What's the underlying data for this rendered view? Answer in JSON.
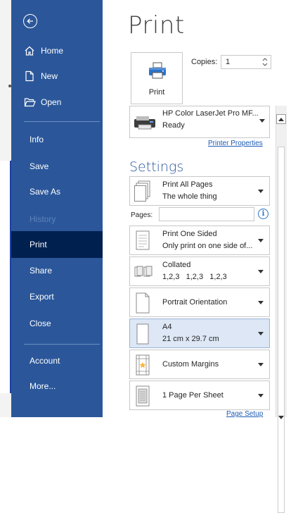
{
  "sidebar": {
    "items": [
      {
        "label": "Home",
        "icon": "home-icon"
      },
      {
        "label": "New",
        "icon": "new-document-icon"
      },
      {
        "label": "Open",
        "icon": "open-folder-icon"
      },
      {
        "label": "Info"
      },
      {
        "label": "Save"
      },
      {
        "label": "Save As"
      },
      {
        "label": "History"
      },
      {
        "label": "Print"
      },
      {
        "label": "Share"
      },
      {
        "label": "Export"
      },
      {
        "label": "Close"
      },
      {
        "label": "Account"
      },
      {
        "label": "More..."
      }
    ]
  },
  "main": {
    "title": "Print",
    "print_button_label": "Print",
    "copies_label": "Copies:",
    "copies_value": "1",
    "printer": {
      "name": "HP Color LaserJet Pro MF...",
      "status": "Ready"
    },
    "printer_properties": "Printer Properties",
    "settings_heading": "Settings",
    "pages_label": "Pages:",
    "page_setup": "Page Setup",
    "options": [
      {
        "line1": "Print All Pages",
        "line2": "The whole thing"
      },
      {
        "line1": "Print One Sided",
        "line2": "Only print on one side of..."
      },
      {
        "line1": "Collated",
        "line2": "1,2,3   1,2,3   1,2,3"
      },
      {
        "line1": "Portrait Orientation",
        "line2": ""
      },
      {
        "line1": "A4",
        "line2": "21 cm x 29.7 cm"
      },
      {
        "line1": "Custom Margins",
        "line2": ""
      },
      {
        "line1": "1 Page Per Sheet",
        "line2": ""
      }
    ]
  },
  "colors": {
    "sidebar": "#2b579a",
    "sidebar_active": "#002050",
    "link": "#1c5ab5",
    "highlight": "#dde7f5"
  }
}
